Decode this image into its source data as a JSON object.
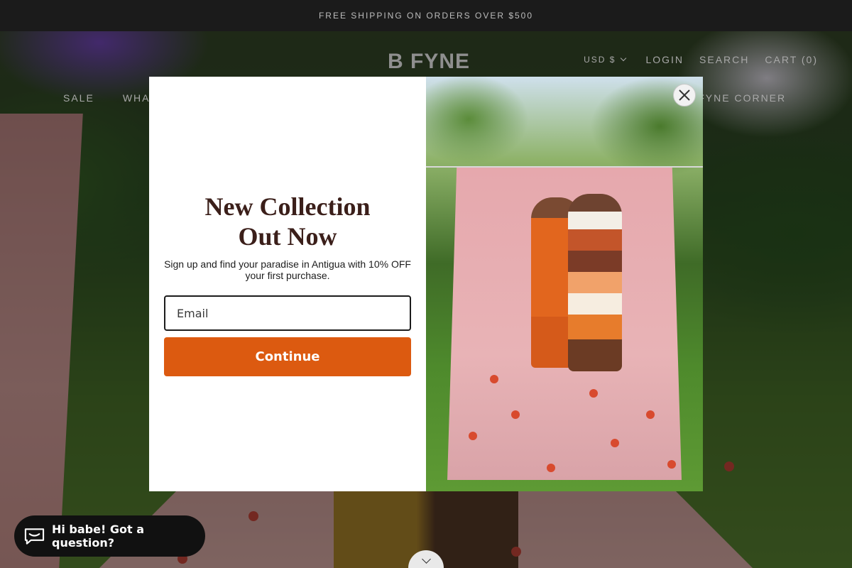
{
  "announcement": "FREE SHIPPING ON ORDERS OVER $500",
  "brand": {
    "logo_text": "B FYNE"
  },
  "header": {
    "currency": "USD $",
    "login": "LOGIN",
    "search": "SEARCH",
    "cart": "CART (0)"
  },
  "nav": {
    "sale": "SALE",
    "whats_new": "WHAT",
    "fyne_corner": "E FYNE CORNER"
  },
  "popup": {
    "title_line1": "New Collection",
    "title_line2": "Out Now",
    "subtitle": "Sign up and find your paradise in Antigua with 10% OFF your first purchase.",
    "email_placeholder": "Email",
    "continue_label": "Continue"
  },
  "chat": {
    "label": "Hi babe! Got a question?"
  },
  "colors": {
    "accent": "#dc5a10",
    "title": "#3b1f1a",
    "announcement_bg": "#1b1b1b"
  },
  "icons": {
    "close": "close-icon",
    "chat": "chat-bubble-icon",
    "scroll": "chevron-down-icon",
    "currency": "chevron-down-icon"
  }
}
